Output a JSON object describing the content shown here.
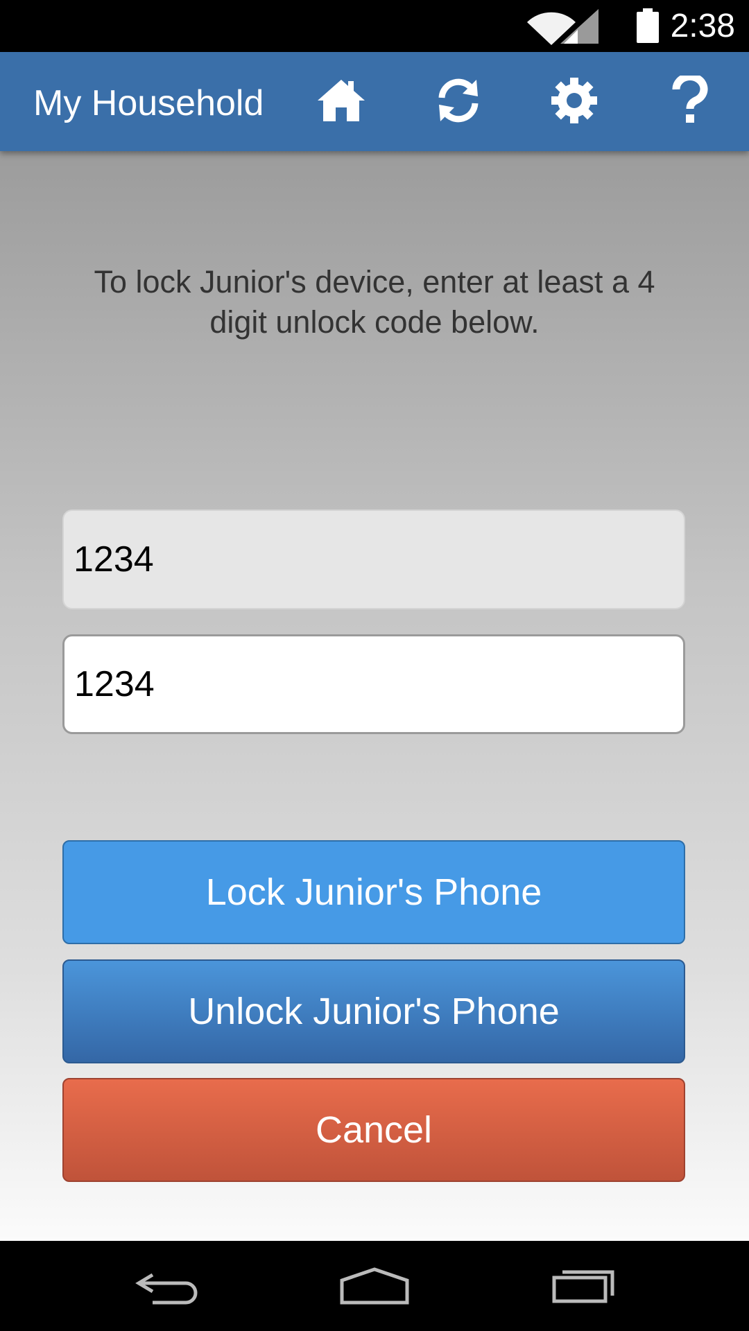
{
  "status_bar": {
    "time": "2:38",
    "icons": [
      "wifi-icon",
      "cell-signal-icon",
      "battery-icon"
    ]
  },
  "app_bar": {
    "title": "My Household",
    "actions": [
      "home-icon",
      "refresh-icon",
      "settings-icon",
      "help-icon"
    ],
    "color": "#3a6fa9"
  },
  "main": {
    "instruction": "To lock Junior's device, enter at least a 4 digit unlock code below.",
    "code_field": {
      "value": "1234"
    },
    "confirm_field": {
      "value": "1234"
    },
    "lock_button": "Lock Junior's Phone",
    "unlock_button": "Unlock Junior's Phone",
    "cancel_button": "Cancel"
  },
  "colors": {
    "lock": "#469ae6",
    "unlock": "#3a7cc2",
    "cancel": "#d95f44"
  },
  "nav_bar": {
    "buttons": [
      "back-icon",
      "home-nav-icon",
      "recents-icon"
    ]
  }
}
